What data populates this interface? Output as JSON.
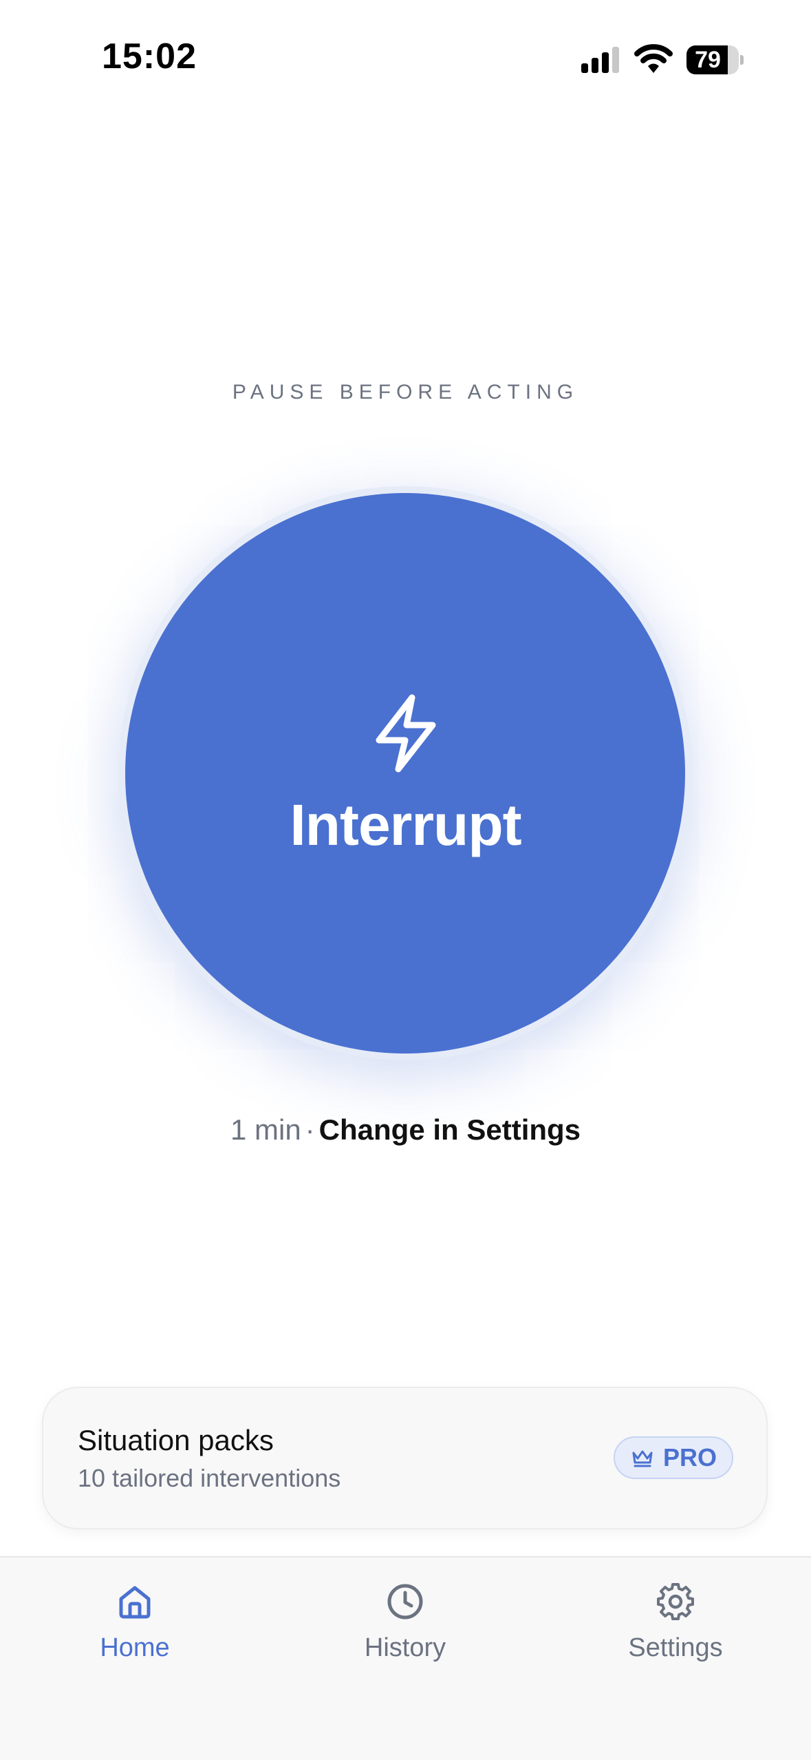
{
  "status_bar": {
    "time": "15:02",
    "battery_level": "79",
    "battery_fraction": 0.79,
    "icons": [
      "signal-icon",
      "wifi-icon",
      "battery-icon"
    ]
  },
  "main": {
    "eyebrow": "PAUSE BEFORE ACTING",
    "interrupt_button": {
      "label": "Interrupt",
      "icon": "lightning-bolt-icon",
      "color": "#4a71d0"
    },
    "duration": {
      "value": "1 min",
      "separator": "·",
      "link": "Change in Settings"
    }
  },
  "packs_card": {
    "title": "Situation packs",
    "subtitle": "10 tailored interventions",
    "badge": {
      "label": "PRO",
      "icon": "crown-icon"
    }
  },
  "tab_bar": {
    "active_color": "#4a71d0",
    "inactive_color": "#6b7280",
    "items": [
      {
        "label": "Home",
        "icon": "home-icon",
        "active": true
      },
      {
        "label": "History",
        "icon": "clock-icon",
        "active": false
      },
      {
        "label": "Settings",
        "icon": "gear-icon",
        "active": false
      }
    ]
  }
}
